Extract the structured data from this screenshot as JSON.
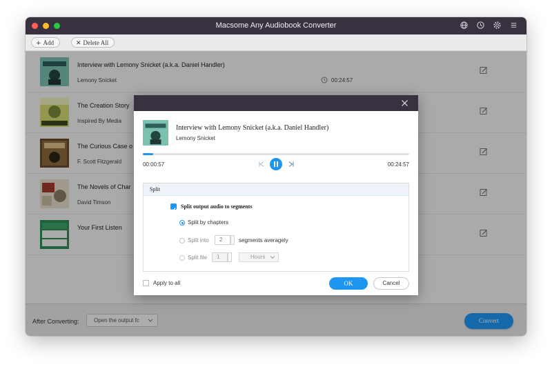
{
  "window": {
    "title": "Macsome Any Audiobook Converter",
    "icons": [
      "globe-icon",
      "history-icon",
      "settings-icon",
      "menu-icon"
    ]
  },
  "toolbar": {
    "add_label": "Add",
    "delete_all_label": "Delete All"
  },
  "books": [
    {
      "title": "Interview with Lemony Snicket (a.k.a. Daniel Handler)",
      "author": "Lemony Snicket",
      "duration": "00:24:57"
    },
    {
      "title": "The Creation Story",
      "author": "Inspired By Media",
      "duration": ""
    },
    {
      "title": "The Curious Case o",
      "author": "F. Scott Fitzgerald",
      "duration": ""
    },
    {
      "title": "The Novels of Char",
      "author": "David Timson",
      "duration": ""
    },
    {
      "title": "Your First Listen",
      "author": "",
      "duration": ""
    }
  ],
  "bottom": {
    "after_label": "After Converting:",
    "after_value": "Open the output fc",
    "convert_label": "Convert"
  },
  "dialog": {
    "title": "Interview with Lemony Snicket (a.k.a. Daniel Handler)",
    "author": "Lemony Snicket",
    "current_time": "00:00:57",
    "total_time": "00:24:57",
    "progress": 0.04,
    "split": {
      "header": "Split",
      "checkbox_label": "Split output audio to segments",
      "option_chapters": "Split by chapters",
      "option_into": "Split into",
      "segments_value": "2",
      "segments_suffix": "segments averagely",
      "option_file": "Split file",
      "file_value": "1",
      "unit_value": "Hours",
      "selected": "chapters"
    },
    "apply_all_label": "Apply to all",
    "ok_label": "OK",
    "cancel_label": "Cancel"
  },
  "colors": {
    "accent": "#1f95f2",
    "titlebar": "#3a3140"
  }
}
